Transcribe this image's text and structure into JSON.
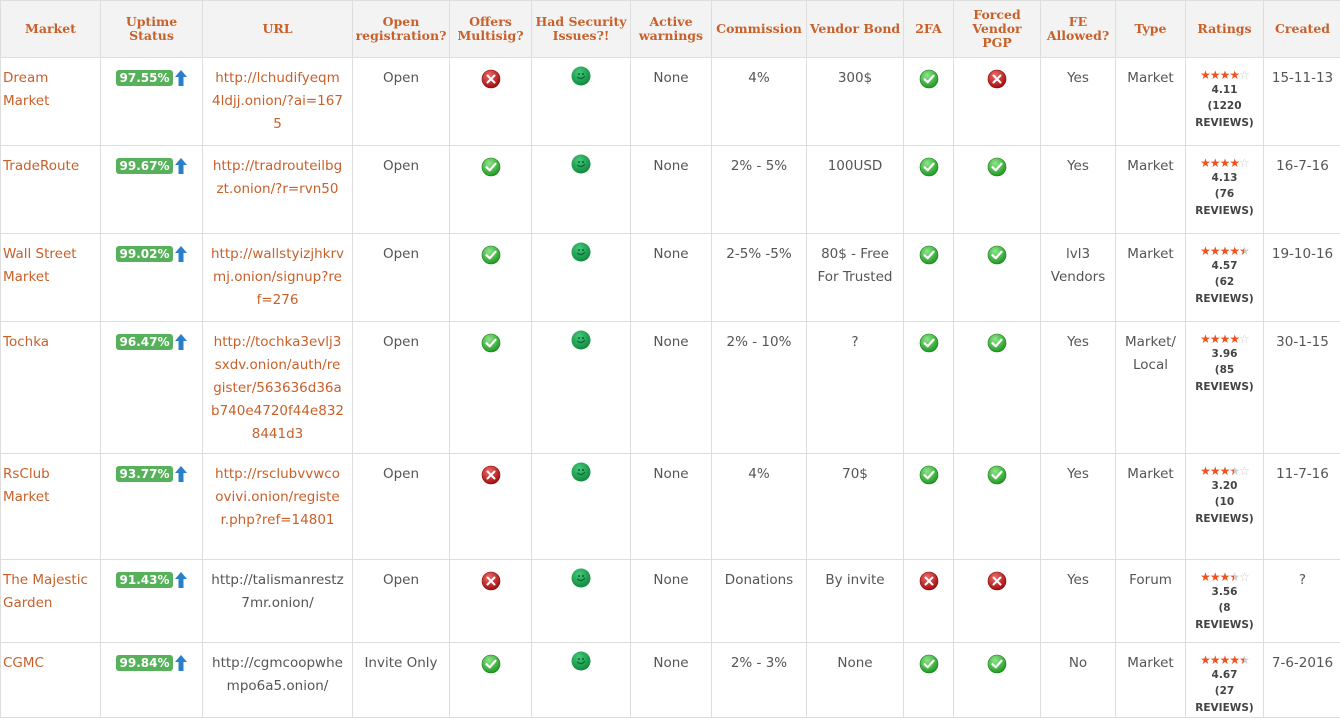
{
  "headers": [
    "Market",
    "Uptime Status",
    "URL",
    "Open registration?",
    "Offers Multisig?",
    "Had Security Issues?!",
    "Active warnings",
    "Commission",
    "Vendor Bond",
    "2FA",
    "Forced Vendor PGP",
    "FE Allowed?",
    "Type",
    "Ratings",
    "Created"
  ],
  "colors": {
    "accent": "#c8602a",
    "badge": "#56b15a",
    "arrow": "#2a7fc8",
    "star": "#f0521e"
  },
  "rows": [
    {
      "market": "Dream Market",
      "uptime": "97.55%",
      "url": "http://lchudifyeqm4ldjj.onion/?ai=1675",
      "url_linked": true,
      "registration": "Open",
      "multisig": "no",
      "security": "smile",
      "warnings": "None",
      "commission": "4%",
      "bond": "300$",
      "twofa": "yes",
      "pgp": "no",
      "fe": "Yes",
      "type": "Market",
      "stars": 4.0,
      "rating": "4.11",
      "reviews": "(1220 REVIEWS)",
      "created": "15-11-13"
    },
    {
      "market": "TradeRoute",
      "uptime": "99.67%",
      "url": "http://tradrouteilbgzt.onion/?r=rvn50",
      "url_linked": true,
      "registration": "Open",
      "multisig": "yes",
      "security": "smile",
      "warnings": "None",
      "commission": "2% - 5%",
      "bond": "100USD",
      "twofa": "yes",
      "pgp": "yes",
      "fe": "Yes",
      "type": "Market",
      "stars": 4.0,
      "rating": "4.13",
      "reviews": "(76 REVIEWS)",
      "created": "16-7-16"
    },
    {
      "market": "Wall Street Market",
      "uptime": "99.02%",
      "url": "http://wallstyizjhkrvmj.onion/signup?ref=276",
      "url_linked": true,
      "registration": "Open",
      "multisig": "yes",
      "security": "smile",
      "warnings": "None",
      "commission": "2-5% -5%",
      "bond": "80$ - Free For Trusted",
      "twofa": "yes",
      "pgp": "yes",
      "fe": "lvl3 Vendors",
      "type": "Market",
      "stars": 4.5,
      "rating": "4.57",
      "reviews": "(62 REVIEWS)",
      "created": "19-10-16"
    },
    {
      "market": "Tochka",
      "uptime": "96.47%",
      "url": "http://tochka3evlj3sxdv.onion/auth/register/563636d36ab740e4720f44e8328441d3",
      "url_linked": true,
      "registration": "Open",
      "multisig": "yes",
      "security": "smile",
      "warnings": "None",
      "commission": "2% - 10%",
      "bond": "?",
      "twofa": "yes",
      "pgp": "yes",
      "fe": "Yes",
      "type": "Market/ Local",
      "stars": 4.0,
      "rating": "3.96",
      "reviews": "(85 REVIEWS)",
      "created": "30-1-15"
    },
    {
      "market": "RsClub Market",
      "uptime": "93.77%",
      "url": "http://rsclubvvwcoovivi.onion/register.php?ref=14801",
      "url_linked": true,
      "registration": "Open",
      "multisig": "no",
      "security": "smile",
      "warnings": "None",
      "commission": "4%",
      "bond": "70$",
      "twofa": "yes",
      "pgp": "yes",
      "fe": "Yes",
      "type": "Market",
      "stars": 3.5,
      "rating": "3.20",
      "reviews": "(10 REVIEWS)",
      "created": "11-7-16"
    },
    {
      "market": "The Majestic Garden",
      "uptime": "91.43%",
      "url": "http://talismanrestz7mr.onion/",
      "url_linked": false,
      "registration": "Open",
      "multisig": "no",
      "security": "smile",
      "warnings": "None",
      "commission": "Donations",
      "bond": "By invite",
      "twofa": "no",
      "pgp": "no",
      "fe": "Yes",
      "type": "Forum",
      "stars": 3.5,
      "rating": "3.56",
      "reviews": "(8 REVIEWS)",
      "created": "?"
    },
    {
      "market": "CGMC",
      "uptime": "99.84%",
      "url": "http://cgmcoopwhempo6a5.onion/",
      "url_linked": false,
      "registration": "Invite Only",
      "multisig": "yes",
      "security": "smile",
      "warnings": "None",
      "commission": "2% - 3%",
      "bond": "None",
      "twofa": "yes",
      "pgp": "yes",
      "fe": "No",
      "type": "Market",
      "stars": 4.5,
      "rating": "4.67",
      "reviews": "(27 REVIEWS)",
      "created": "7-6-2016"
    }
  ]
}
